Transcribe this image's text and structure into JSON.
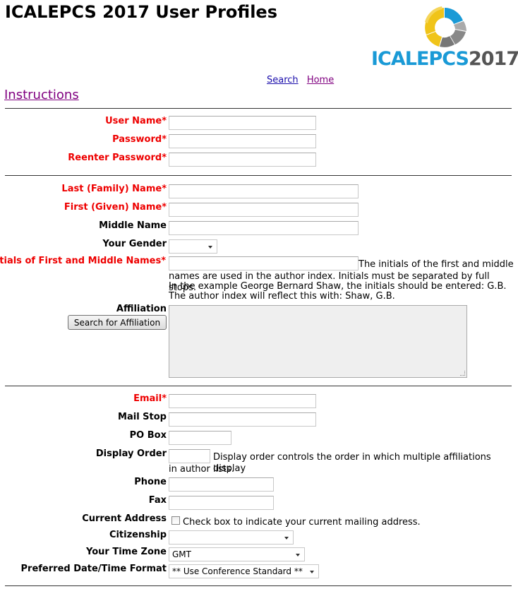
{
  "header": {
    "title": "ICALEPCS 2017 User Profiles",
    "logo_text_left": "ICALEPCS",
    "logo_text_right": "2017",
    "colors": {
      "logo_blue": "#1a9ad6",
      "logo_yellow": "#f0c419",
      "logo_gray": "#777777"
    }
  },
  "nav": {
    "links": [
      {
        "label": "Search"
      },
      {
        "label": "Home"
      }
    ],
    "instructions": "Instructions"
  },
  "colors": {
    "required_label": "#e00000",
    "link": "#1a0dab",
    "visited_link": "#800080"
  },
  "account": {
    "user_name": {
      "label": "User Name*",
      "value": ""
    },
    "password": {
      "label": "Password*",
      "value": ""
    },
    "reenter_password": {
      "label": "Reenter Password*",
      "value": ""
    }
  },
  "name": {
    "last": {
      "label": "Last (Family) Name*",
      "value": ""
    },
    "first": {
      "label": "First (Given) Name*",
      "value": ""
    },
    "middle": {
      "label": "Middle Name",
      "value": ""
    },
    "gender": {
      "label": "Your Gender",
      "value": ""
    },
    "initials": {
      "label": "Initials of First and Middle Names*",
      "value": "",
      "help_line1": "The initials of the first and middle",
      "help_line2": "names are used in the author index. Initials must be separated by full stops.",
      "help_line3": "In the example George Bernard Shaw, the initials should be entered: G.B.",
      "help_line4": "The author index will reflect this with: Shaw, G.B."
    },
    "affiliation": {
      "label": "Affiliation",
      "button": "Search for Affiliation",
      "value": ""
    }
  },
  "contact": {
    "email": {
      "label": "Email*",
      "value": ""
    },
    "mail_stop": {
      "label": "Mail Stop",
      "value": ""
    },
    "po_box": {
      "label": "PO Box",
      "value": ""
    },
    "display_order": {
      "label": "Display Order",
      "value": "",
      "help_line1": "Display order controls the order in which multiple affiliations display",
      "help_line2": "in author lists."
    },
    "phone": {
      "label": "Phone",
      "value": ""
    },
    "fax": {
      "label": "Fax",
      "value": ""
    },
    "current_address": {
      "label": "Current Address",
      "checked": false,
      "help": "Check box to indicate your current mailing address."
    },
    "citizenship": {
      "label": "Citizenship",
      "value": ""
    },
    "time_zone": {
      "label": "Your Time Zone",
      "value": "GMT"
    },
    "date_format": {
      "label": "Preferred Date/Time Format",
      "value": "** Use Conference Standard **"
    }
  }
}
